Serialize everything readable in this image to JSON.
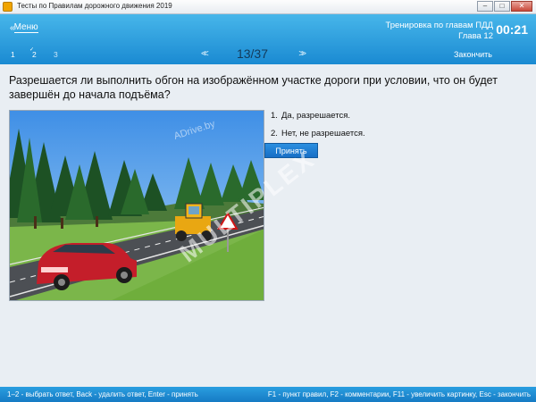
{
  "window": {
    "title": "Тесты по Правилам дорожного движения 2019",
    "min_glyph": "–",
    "max_glyph": "□",
    "close_glyph": "✕"
  },
  "header": {
    "menu_label": "Меню",
    "course_title": "Тренировка по главам ПДД",
    "chapter": "Глава 12",
    "timer": "00:21",
    "question_tabs": [
      {
        "label": "1"
      },
      {
        "label": "2",
        "mark": "✓"
      },
      {
        "label": "3"
      }
    ],
    "counter": "13/37",
    "finish_label": "Закончить",
    "prev_glyph": "<<",
    "next_glyph": ">>"
  },
  "question": {
    "text": "Разрешается ли выполнить обгон на изображённом участке дороги при условии, что он будет завершён до начала подъёма?"
  },
  "picture": {
    "watermark": "ADrive.by"
  },
  "answers": [
    {
      "num": "1.",
      "text": "Да, разрешается."
    },
    {
      "num": "2.",
      "text": "Нет, не разрешается."
    }
  ],
  "accept_label": "Принять",
  "overlay_watermark": "MULTIPLEX",
  "statusbar": {
    "left": "1–2 - выбрать ответ, Back - удалить ответ, Enter - принять",
    "right": "F1 - пункт правил, F2 - комментарии, F11 - увеличить картинку, Esc - закончить"
  },
  "colors": {
    "header_top": "#47b6ea",
    "header_bottom": "#1a8ad2",
    "accept_button": "#1f7fd3"
  }
}
